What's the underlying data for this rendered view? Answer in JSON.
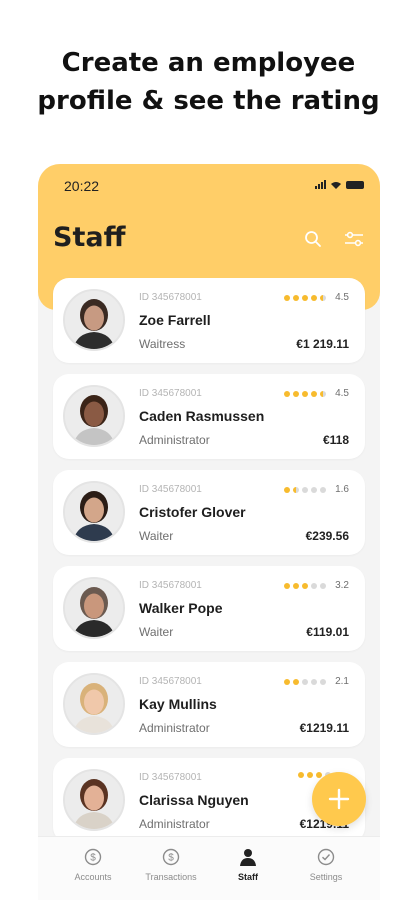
{
  "headline": {
    "line1": "Create an employee",
    "line2": "profile & see the rating"
  },
  "status_bar": {
    "time": "20:22"
  },
  "header": {
    "title": "Staff",
    "search_icon": "search-icon",
    "filter_icon": "filter-sliders-icon"
  },
  "colors": {
    "accent": "#ffce68",
    "star": "#f7bb2e",
    "fab": "#ffc94d"
  },
  "employees": [
    {
      "id": "ID 345678001",
      "name": "Zoe Farrell",
      "role": "Waitress",
      "amount": "€1 219.11",
      "rating": "4.5",
      "rating_value": 4.5
    },
    {
      "id": "ID 345678001",
      "name": "Caden Rasmussen",
      "role": "Administrator",
      "amount": "€118",
      "rating": "4.5",
      "rating_value": 4.5
    },
    {
      "id": "ID 345678001",
      "name": "Cristofer Glover",
      "role": "Waiter",
      "amount": "€239.56",
      "rating": "1.6",
      "rating_value": 1.5
    },
    {
      "id": "ID 345678001",
      "name": "Walker Pope",
      "role": "Waiter",
      "amount": "€119.01",
      "rating": "3.2",
      "rating_value": 3
    },
    {
      "id": "ID 345678001",
      "name": "Kay Mullins",
      "role": "Administrator",
      "amount": "€1219.11",
      "rating": "2.1",
      "rating_value": 2
    },
    {
      "id": "ID 345678001",
      "name": "Clarissa Nguyen",
      "role": "Administrator",
      "amount": "€1219.11",
      "rating": "",
      "rating_value": 3
    }
  ],
  "tabs": [
    {
      "label": "Accounts",
      "icon": "dollar-circle-icon",
      "active": false
    },
    {
      "label": "Transactions",
      "icon": "dollar-circle-icon",
      "active": false
    },
    {
      "label": "Staff",
      "icon": "person-icon",
      "active": true
    },
    {
      "label": "Settings",
      "icon": "check-circle-icon",
      "active": false
    }
  ]
}
